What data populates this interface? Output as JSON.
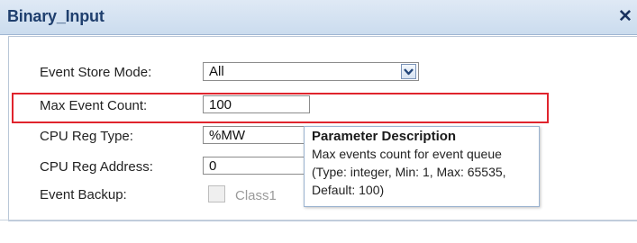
{
  "window": {
    "title": "Binary_Input",
    "close_symbol": "✕"
  },
  "form": {
    "event_store_mode": {
      "label": "Event Store Mode:",
      "value": "All"
    },
    "max_event_count": {
      "label": "Max Event Count:",
      "value": "100"
    },
    "cpu_reg_type": {
      "label": "CPU Reg Type:",
      "value": "%MW"
    },
    "cpu_reg_address": {
      "label": "CPU Reg Address:",
      "value": "0"
    },
    "event_backup": {
      "label": "Event Backup:",
      "option_label": "Class1",
      "checked": false
    }
  },
  "tooltip": {
    "title": "Parameter Description",
    "lines": [
      "Max events count for event queue",
      "(Type: integer, Min: 1, Max: 65535,",
      "Default: 100)"
    ]
  },
  "colors": {
    "highlight": "#e0242d",
    "title_text": "#1f3f6e"
  }
}
